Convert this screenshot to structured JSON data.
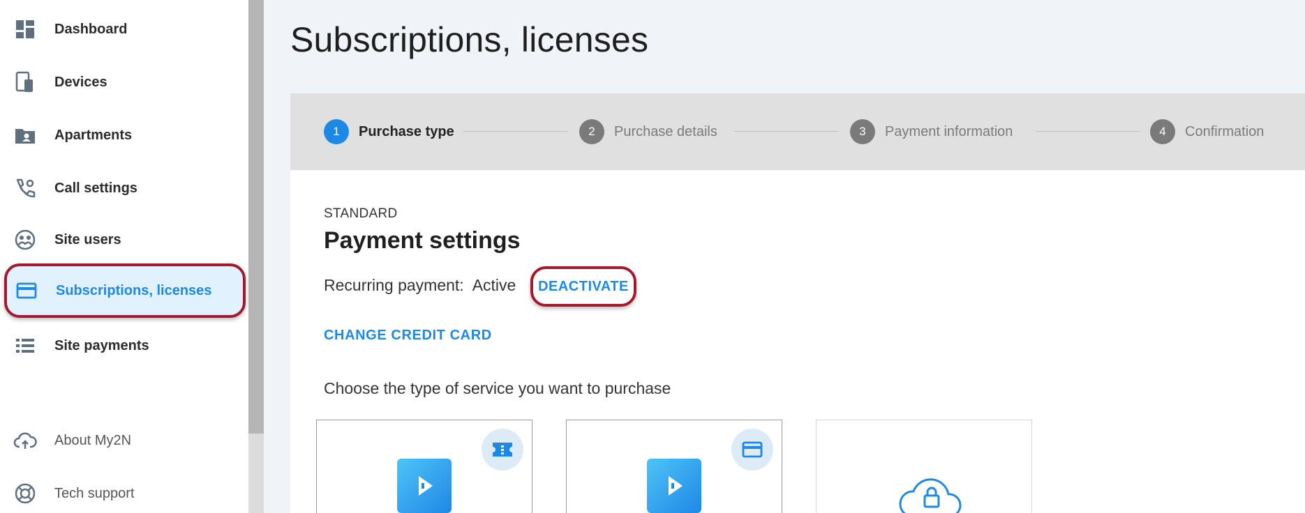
{
  "sidebar": {
    "items": [
      {
        "label": "Dashboard",
        "icon": "dashboard-icon"
      },
      {
        "label": "Devices",
        "icon": "devices-icon"
      },
      {
        "label": "Apartments",
        "icon": "apartments-icon"
      },
      {
        "label": "Call settings",
        "icon": "call-settings-icon"
      },
      {
        "label": "Site users",
        "icon": "site-users-icon"
      },
      {
        "label": "Subscriptions, licenses",
        "icon": "credit-card-icon",
        "active": true
      },
      {
        "label": "Site payments",
        "icon": "list-icon"
      }
    ],
    "bottom_items": [
      {
        "label": "About My2N",
        "icon": "cloud-upload-icon"
      },
      {
        "label": "Tech support",
        "icon": "lifebuoy-icon"
      }
    ]
  },
  "page": {
    "title": "Subscriptions, licenses"
  },
  "stepper": {
    "steps": [
      {
        "number": "1",
        "label": "Purchase type",
        "active": true
      },
      {
        "number": "2",
        "label": "Purchase details",
        "active": false
      },
      {
        "number": "3",
        "label": "Payment information",
        "active": false
      },
      {
        "number": "4",
        "label": "Confirmation",
        "active": false
      }
    ]
  },
  "payment": {
    "plan": "STANDARD",
    "title": "Payment settings",
    "recurring_label": "Recurring payment:",
    "recurring_status": "Active",
    "deactivate_label": "DEACTIVATE",
    "change_card_label": "CHANGE CREDIT CARD",
    "choose_text": "Choose the type of service you want to purchase"
  },
  "colors": {
    "accent": "#1e88e5",
    "highlight_border": "#a3192e",
    "active_item_bg": "#e1f1fd",
    "stepper_bg": "#e0e0e0",
    "page_bg": "#f0f3f7"
  }
}
